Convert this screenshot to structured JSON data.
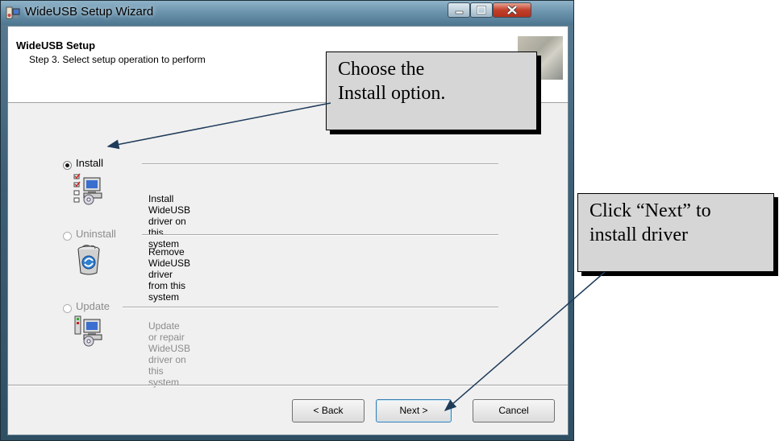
{
  "window": {
    "title": "WideUSB Setup Wizard",
    "header_title": "WideUSB Setup",
    "header_subtitle": "Step 3. Select setup operation to perform"
  },
  "options": [
    {
      "label": "Install",
      "description": "Install WideUSB driver on this system",
      "selected": true,
      "enabled": true,
      "icon": "install-icon"
    },
    {
      "label": "Uninstall",
      "description": "Remove WideUSB driver from this system",
      "selected": false,
      "enabled": false,
      "icon": "recycle-bin-icon"
    },
    {
      "label": "Update",
      "description": "Update or repair WideUSB driver on this system",
      "selected": false,
      "enabled": false,
      "icon": "update-icon"
    }
  ],
  "buttons": {
    "back": "< Back",
    "next": "Next >",
    "cancel": "Cancel"
  },
  "callouts": {
    "install_line1": "Choose the",
    "install_line2": "Install option.",
    "next_line1": "Click “Next” to",
    "next_line2": "install driver"
  },
  "colors": {
    "callout_bg": "#d6d6d6",
    "arrow": "#1f3b5a"
  }
}
